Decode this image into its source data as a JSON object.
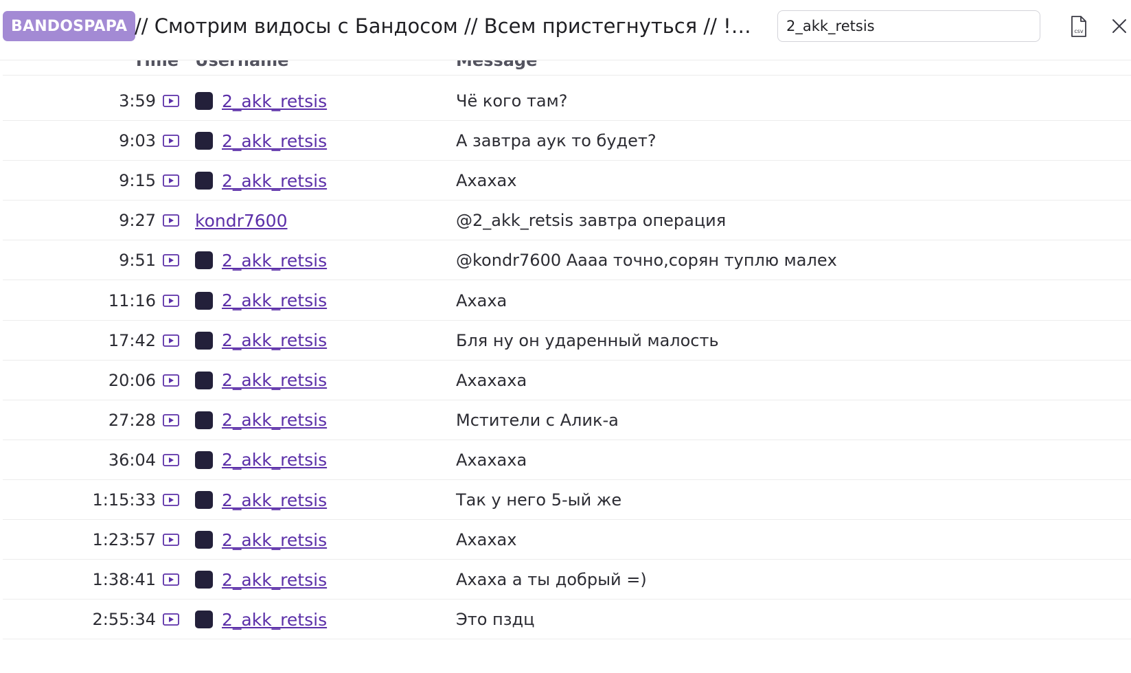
{
  "header": {
    "channel": "BANDOSPAPA",
    "title": "// Смотрим видосы с Бандосом // Всем пристегнуться // !тг...",
    "search_value": "2_akk_retsis",
    "csv_icon": "csv-file-icon",
    "close_icon": "close-icon"
  },
  "table": {
    "columns": {
      "time": "Time",
      "username": "Username",
      "message": "Message"
    },
    "rows": [
      {
        "time": "3:59",
        "user": "2_akk_retsis",
        "avatar": true,
        "message": "Чё кого там?"
      },
      {
        "time": "9:03",
        "user": "2_akk_retsis",
        "avatar": true,
        "message": "А завтра аук то будет?"
      },
      {
        "time": "9:15",
        "user": "2_akk_retsis",
        "avatar": true,
        "message": "Ахахах"
      },
      {
        "time": "9:27",
        "user": "kondr7600",
        "avatar": false,
        "message": "@2_akk_retsis завтра операция"
      },
      {
        "time": "9:51",
        "user": "2_akk_retsis",
        "avatar": true,
        "message": "@kondr7600 Аааа точно,сорян туплю малех"
      },
      {
        "time": "11:16",
        "user": "2_akk_retsis",
        "avatar": true,
        "message": "Ахаха"
      },
      {
        "time": "17:42",
        "user": "2_akk_retsis",
        "avatar": true,
        "message": "Бля ну он ударенный малость"
      },
      {
        "time": "20:06",
        "user": "2_akk_retsis",
        "avatar": true,
        "message": "Ахахаха"
      },
      {
        "time": "27:28",
        "user": "2_akk_retsis",
        "avatar": true,
        "message": "Мстители с Алик-а"
      },
      {
        "time": "36:04",
        "user": "2_akk_retsis",
        "avatar": true,
        "message": "Ахахаха"
      },
      {
        "time": "1:15:33",
        "user": "2_akk_retsis",
        "avatar": true,
        "message": "Так у него 5-ый же"
      },
      {
        "time": "1:23:57",
        "user": "2_akk_retsis",
        "avatar": true,
        "message": "Ахахах"
      },
      {
        "time": "1:38:41",
        "user": "2_akk_retsis",
        "avatar": true,
        "message": "Ахаха а ты добрый =)"
      },
      {
        "time": "2:55:34",
        "user": "2_akk_retsis",
        "avatar": true,
        "message": "Это пздц"
      }
    ]
  },
  "colors": {
    "badge": "#a38ad4",
    "username_link": "#5b2fa8",
    "row_divider": "#ececec"
  }
}
